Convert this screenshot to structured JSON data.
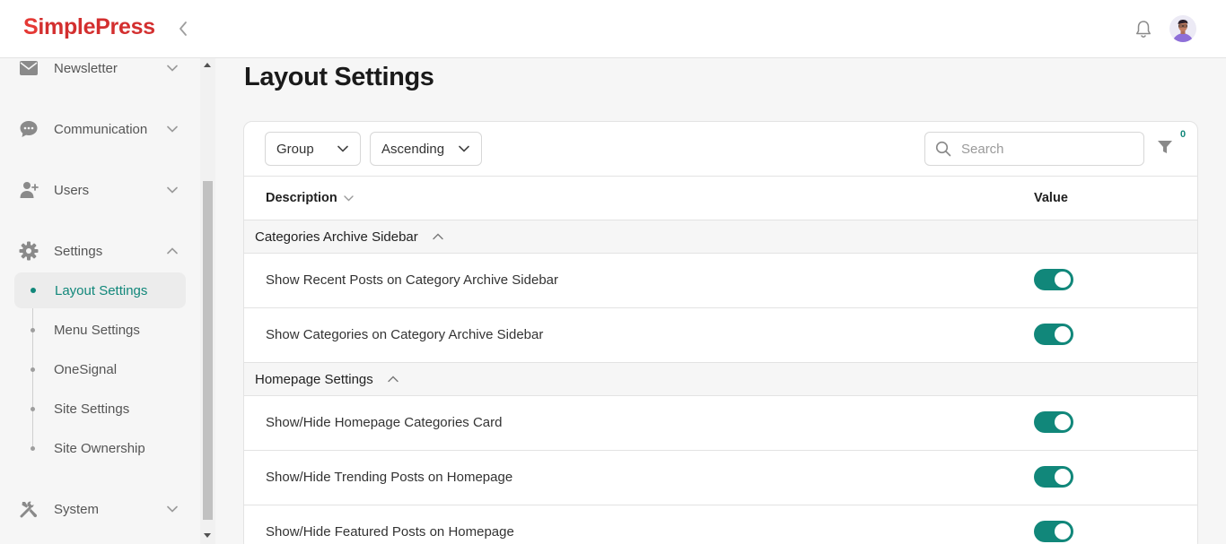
{
  "app": {
    "logo_first": "S",
    "logo_rest": "imple",
    "logo_second": "Press"
  },
  "sidebar": {
    "items": [
      {
        "label": "Newsletter",
        "icon": "envelope-icon"
      },
      {
        "label": "Communication",
        "icon": "chat-bubble-icon"
      },
      {
        "label": "Users",
        "icon": "user-plus-icon"
      },
      {
        "label": "Settings",
        "icon": "gear-icon"
      },
      {
        "label": "System",
        "icon": "tools-icon"
      }
    ],
    "settings_sub": [
      {
        "label": "Layout Settings",
        "active": true
      },
      {
        "label": "Menu Settings"
      },
      {
        "label": "OneSignal"
      },
      {
        "label": "Site Settings"
      },
      {
        "label": "Site Ownership"
      }
    ]
  },
  "page": {
    "title": "Layout Settings"
  },
  "toolbar": {
    "group_select": "Group",
    "order_select": "Ascending",
    "search_placeholder": "Search",
    "filter_count": "0"
  },
  "table": {
    "col_description": "Description",
    "col_value": "Value",
    "groups": [
      {
        "label": "Categories Archive Sidebar",
        "rows": [
          {
            "label": "Show Recent Posts on Category Archive Sidebar",
            "value": true
          },
          {
            "label": "Show Categories on Category Archive Sidebar",
            "value": true
          }
        ]
      },
      {
        "label": "Homepage Settings",
        "rows": [
          {
            "label": "Show/Hide Homepage Categories Card",
            "value": true
          },
          {
            "label": "Show/Hide Trending Posts on Homepage",
            "value": true
          },
          {
            "label": "Show/Hide Featured Posts on Homepage",
            "value": true
          }
        ]
      }
    ]
  },
  "colors": {
    "accent": "#11877a",
    "brand_red": "#d32f2f"
  }
}
